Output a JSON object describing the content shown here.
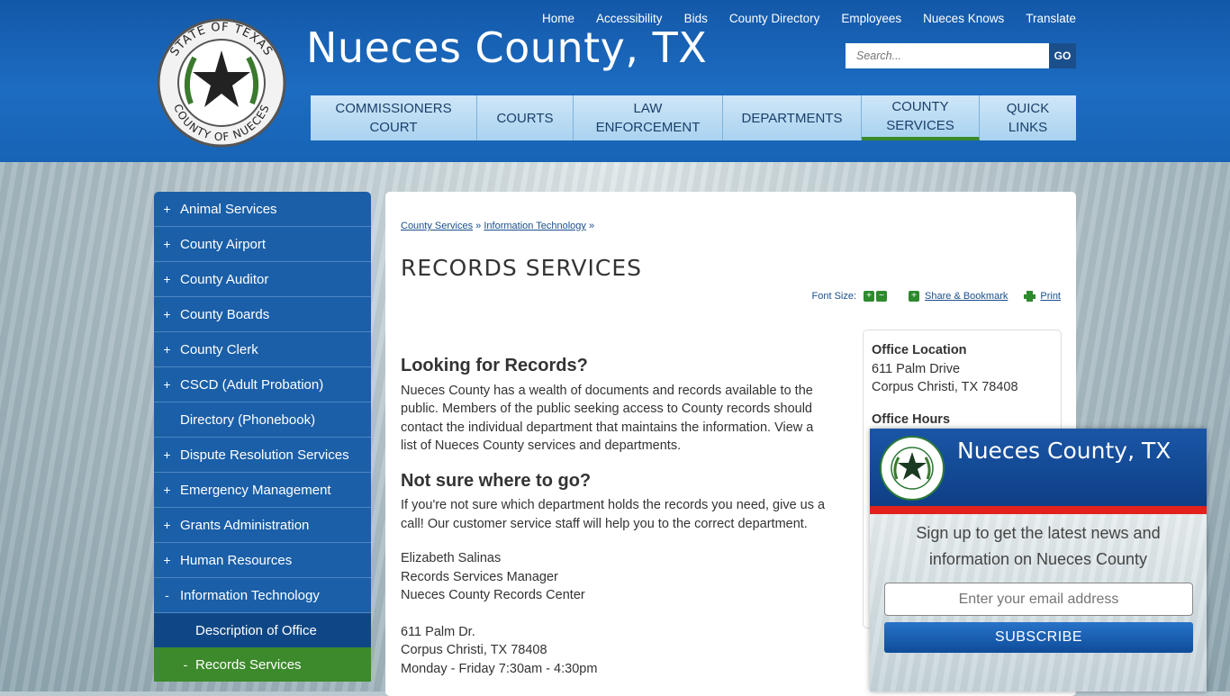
{
  "site": {
    "title": "Nueces County, TX",
    "seal_top_text": "STATE OF TEXAS",
    "seal_bottom_text": "COUNTY OF NUECES"
  },
  "topnav": [
    "Home",
    "Accessibility",
    "Bids",
    "County Directory",
    "Employees",
    "Nueces Knows",
    "Translate"
  ],
  "search": {
    "placeholder": "Search...",
    "go": "GO"
  },
  "mainnav": [
    {
      "label": "COMMISSIONERS\nCOURT"
    },
    {
      "label": "COURTS"
    },
    {
      "label": "LAW\nENFORCEMENT"
    },
    {
      "label": "DEPARTMENTS"
    },
    {
      "label": "COUNTY\nSERVICES",
      "active": true
    },
    {
      "label": "QUICK\nLINKS"
    }
  ],
  "sidebar": {
    "items": [
      {
        "pm": "+",
        "label": "Animal Services"
      },
      {
        "pm": "+",
        "label": "County Airport"
      },
      {
        "pm": "+",
        "label": "County Auditor"
      },
      {
        "pm": "+",
        "label": "County Boards"
      },
      {
        "pm": "+",
        "label": "County Clerk"
      },
      {
        "pm": "+",
        "label": "CSCD (Adult Probation)"
      },
      {
        "pm": "",
        "label": "Directory (Phonebook)"
      },
      {
        "pm": "+",
        "label": "Dispute Resolution Services"
      },
      {
        "pm": "+",
        "label": "Emergency Management"
      },
      {
        "pm": "+",
        "label": "Grants Administration"
      },
      {
        "pm": "+",
        "label": "Human Resources"
      },
      {
        "pm": "-",
        "label": "Information Technology"
      }
    ],
    "sub": {
      "description": "Description of Office",
      "records_pm": "-",
      "records": "Records Services"
    }
  },
  "breadcrumb": {
    "crumb1": "County Services",
    "sep": "»",
    "crumb2": "Information Technology"
  },
  "page": {
    "title": "RECORDS SERVICES"
  },
  "tools": {
    "font_size": "Font Size:",
    "share": "Share & Bookmark",
    "print": "Print",
    "plus": "+",
    "minus": "−"
  },
  "content": {
    "h1": "Looking for Records?",
    "p1": "Nueces County has a wealth of documents and records available to the public. Members of the public seeking access to County records should contact the individual department that maintains the information. View a list of Nueces County services and departments.",
    "h2": "Not sure where to go?",
    "p2": "If you're not sure which department holds the records you need, give us a call! Our customer service staff will help you to the correct department.",
    "contact_name": "Elizabeth Salinas",
    "contact_title": "Records Services Manager",
    "contact_org": "Nueces County Records Center",
    "addr1": "611 Palm Dr.",
    "addr2": "Corpus Christi, TX 78408",
    "hours": "Monday - Friday 7:30am - 4:30pm"
  },
  "infobox": {
    "loc_heading": "Office Location",
    "loc1": "611 Palm Drive",
    "loc2": "Corpus Christi, TX 78408",
    "hours_heading": "Office Hours"
  },
  "popup": {
    "title": "Nueces County, TX",
    "text": "Sign up to get the latest news and information on Nueces County",
    "email_placeholder": "Enter your email address",
    "subscribe": "SUBSCRIBE"
  },
  "colors": {
    "header_blue": "#1763b5",
    "nav_light": "#a9d3f0",
    "sidebar_blue": "#1a5fa8",
    "active_green": "#3c8a2b",
    "popup_red": "#e2211c"
  }
}
